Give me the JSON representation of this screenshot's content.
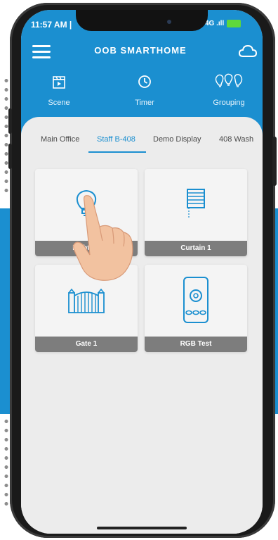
{
  "status_bar": {
    "time": "11:57 AM |",
    "right": "4G .ıll"
  },
  "header": {
    "title": "OOB SMARTHOME"
  },
  "quick_actions": [
    {
      "label": "Scene",
      "icon": "clapperboard-icon"
    },
    {
      "label": "Timer",
      "icon": "clock-icon"
    },
    {
      "label": "Grouping",
      "icon": "bulbs-icon"
    }
  ],
  "tabs": [
    {
      "label": "Main Office",
      "active": false
    },
    {
      "label": "Staff B-408",
      "active": true
    },
    {
      "label": "Demo Display",
      "active": false
    },
    {
      "label": "408 Wash",
      "active": false
    }
  ],
  "devices": [
    {
      "label": "Lighting",
      "icon": "bulb-icon"
    },
    {
      "label": "Curtain 1",
      "icon": "curtain-icon"
    },
    {
      "label": "Gate 1",
      "icon": "gate-icon"
    },
    {
      "label": "RGB Test",
      "icon": "remote-icon"
    }
  ],
  "colors": {
    "accent": "#1b8fd0",
    "card_label": "#7d7d7d",
    "background": "#ececec"
  }
}
